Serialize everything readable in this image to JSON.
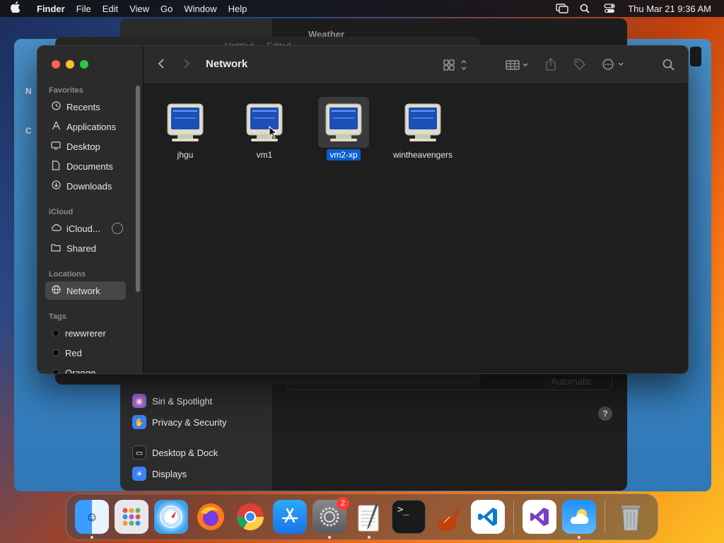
{
  "menubar": {
    "apple": "",
    "app_name": "Finder",
    "menus": [
      "File",
      "Edit",
      "View",
      "Go",
      "Window",
      "Help"
    ],
    "clock": "Thu Mar 21  9:36 AM"
  },
  "background": {
    "weather_title": "Weather",
    "textedit_title": "Untitled — Edited",
    "settings_items": [
      {
        "label": "Siri & Spotlight",
        "icon": "siri-icon"
      },
      {
        "label": "Privacy & Security",
        "icon": "hand-icon"
      },
      {
        "label": "Desktop & Dock",
        "icon": "desktop-dock-icon"
      },
      {
        "label": "Displays",
        "icon": "displays-icon"
      }
    ],
    "appearance_select": "Automatic",
    "help": "?"
  },
  "finder": {
    "title": "Network",
    "sidebar": {
      "favorites_title": "Favorites",
      "favorites": [
        {
          "label": "Recents",
          "icon": "clock-icon"
        },
        {
          "label": "Applications",
          "icon": "applications-icon"
        },
        {
          "label": "Desktop",
          "icon": "desktop-icon"
        },
        {
          "label": "Documents",
          "icon": "document-icon"
        },
        {
          "label": "Downloads",
          "icon": "download-icon"
        }
      ],
      "icloud_title": "iCloud",
      "icloud": [
        {
          "label": "iCloud...",
          "icon": "cloud-icon"
        },
        {
          "label": "Shared",
          "icon": "shared-folder-icon"
        }
      ],
      "locations_title": "Locations",
      "locations": [
        {
          "label": "Network",
          "icon": "globe-icon",
          "selected": true
        }
      ],
      "tags_title": "Tags",
      "tags": [
        {
          "label": "rewwrerer"
        },
        {
          "label": "Red"
        },
        {
          "label": "Orange"
        }
      ]
    },
    "items": [
      {
        "label": "jhgu",
        "selected": false
      },
      {
        "label": "vm1",
        "selected": false
      },
      {
        "label": "vm2-xp",
        "selected": true
      },
      {
        "label": "wintheavengers",
        "selected": false
      }
    ]
  },
  "dock": {
    "apps": [
      {
        "name": "Finder",
        "icon": "finder-icon",
        "running": true
      },
      {
        "name": "Launchpad",
        "icon": "launchpad-icon",
        "running": false
      },
      {
        "name": "Safari",
        "icon": "safari-icon",
        "running": false
      },
      {
        "name": "Firefox",
        "icon": "firefox-icon",
        "running": false
      },
      {
        "name": "Chrome",
        "icon": "chrome-icon",
        "running": false
      },
      {
        "name": "App Store",
        "icon": "app-store-icon",
        "running": false
      },
      {
        "name": "System Settings",
        "icon": "system-settings-icon",
        "running": true,
        "badge": "2"
      },
      {
        "name": "TextEdit",
        "icon": "textedit-icon",
        "running": true
      },
      {
        "name": "Terminal",
        "icon": "terminal-icon",
        "running": false
      },
      {
        "name": "GarageBand",
        "icon": "garageband-icon",
        "running": false
      },
      {
        "name": "VS Code",
        "icon": "vscode-icon",
        "running": false
      },
      {
        "name": "Visual Studio",
        "icon": "visual-studio-icon",
        "running": false
      },
      {
        "name": "Weather",
        "icon": "weather-icon",
        "running": true
      },
      {
        "name": "Trash",
        "icon": "trash-icon",
        "running": false
      }
    ]
  }
}
